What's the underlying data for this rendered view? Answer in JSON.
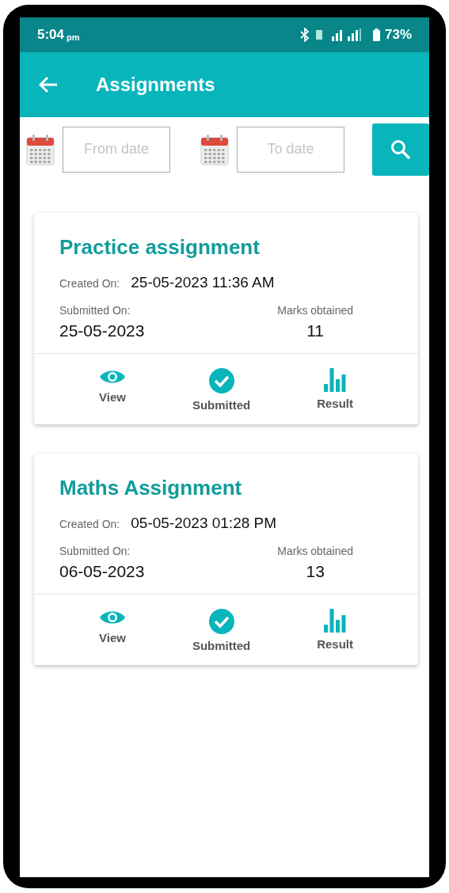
{
  "status_bar": {
    "time": "5:04",
    "time_suffix": "pm",
    "battery": "73%"
  },
  "app_bar": {
    "title": "Assignments"
  },
  "filters": {
    "from_placeholder": "From date",
    "to_placeholder": "To date"
  },
  "assignments": [
    {
      "title": "Practice assignment",
      "created_label": "Created On:",
      "created_value": "25-05-2023 11:36 AM",
      "submitted_label": "Submitted On:",
      "submitted_value": "25-05-2023",
      "marks_label": "Marks obtained",
      "marks_value": "11",
      "actions": [
        {
          "kind": "view",
          "label": "View"
        },
        {
          "kind": "submitted",
          "label": "Submitted"
        },
        {
          "kind": "result",
          "label": "Result"
        }
      ]
    },
    {
      "title": "Maths Assignment",
      "created_label": "Created On:",
      "created_value": "05-05-2023 01:28 PM",
      "submitted_label": "Submitted On:",
      "submitted_value": "06-05-2023",
      "marks_label": "Marks obtained",
      "marks_value": "13",
      "actions": [
        {
          "kind": "view",
          "label": "View"
        },
        {
          "kind": "submitted",
          "label": "Submitted"
        },
        {
          "kind": "result",
          "label": "Result"
        }
      ]
    }
  ]
}
